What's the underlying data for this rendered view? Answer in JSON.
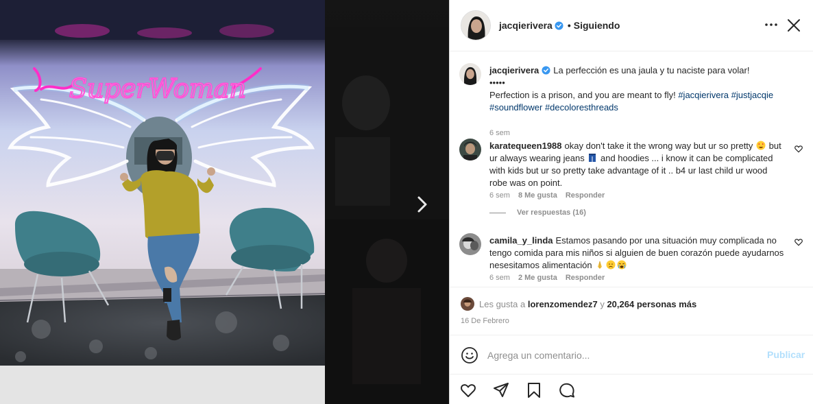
{
  "media": {
    "neon_sign_text": "SuperWoman",
    "next_icon": "chevron-right-icon"
  },
  "header": {
    "username": "jacqierivera",
    "verified_icon": "verified-badge-icon",
    "dot": "•",
    "follow_status": "Siguiendo",
    "more_icon": "more-options-icon",
    "close_icon": "close-icon"
  },
  "caption": {
    "username": "jacqierivera",
    "line1": "La perfección es una jaula y tu naciste para volar!",
    "line2": "•••••",
    "text_en": "Perfection is a prison, and you are meant to fly!",
    "hashtags": [
      "#jacqierivera",
      "#justjacqie",
      "#soundflower",
      "#decoloresthreads"
    ],
    "time": "6 sem"
  },
  "comments": [
    {
      "username": "karatequeen1988",
      "text_parts": [
        "okay don't take it the wrong way but ur so pretty",
        "but ur always wearing jeans",
        "and hoodies ... i know it can be complicated with kids but ur so pretty take advantage of it .. b4 ur last child ur wood robe was on point."
      ],
      "time": "6 sem",
      "likes": "8 Me gusta",
      "reply": "Responder",
      "view_replies": "Ver respuestas (16)"
    },
    {
      "username": "camila_y_linda",
      "text": "Estamos pasando por una situación muy complicada no tengo comida para mis niños si alguien de buen corazón puede ayudarnos nesesitamos alimentación",
      "time": "6 sem",
      "likes": "2 Me gusta",
      "reply": "Responder"
    }
  ],
  "likes": {
    "prefix": "Les gusta a",
    "user": "lorenzomendez7",
    "conjunction": "y",
    "others": "20,264 personas más"
  },
  "date": "16 De Febrero",
  "comment_box": {
    "placeholder": "Agrega un comentario...",
    "publish": "Publicar",
    "emoji_icon": "smiley-icon"
  },
  "actions": [
    "heart-icon",
    "share-icon",
    "save-icon",
    "comment-icon"
  ],
  "colors": {
    "link": "#00376b",
    "muted": "#8e8e8e",
    "publish_disabled": "#b2dffc",
    "verified": "#3897f0",
    "neon_pink": "#ff2ec8"
  }
}
